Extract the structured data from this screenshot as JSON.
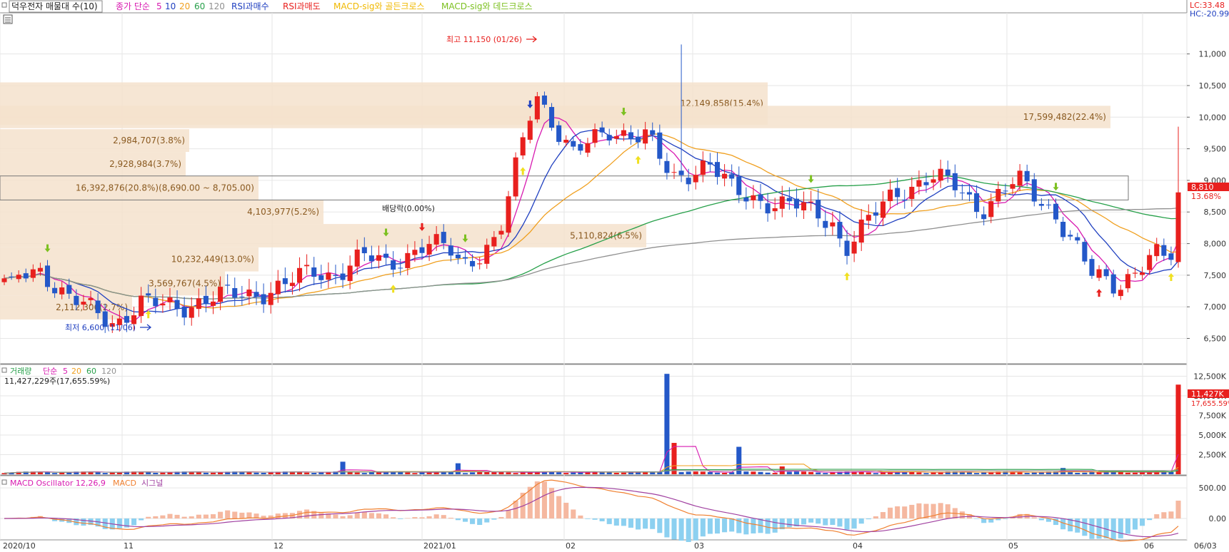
{
  "header": {
    "title": "덕우전자 매물대 수(10)",
    "ma_label": "종가 단순",
    "ma_periods": [
      "5",
      "10",
      "20",
      "60",
      "120"
    ],
    "rsi_buy": "RSI과매수",
    "rsi_sell": "RSI과매도",
    "golden_cross": "MACD-sig와 골든크로스",
    "dead_cross": "MACD-sig와 데드크로스",
    "lc_label": "LC:33.48",
    "hc_label": "HC:-20.99"
  },
  "colors": {
    "up": "#e8201e",
    "down": "#2458c8",
    "ma5": "#d81ab0",
    "ma10": "#2040c0",
    "ma20": "#f0a020",
    "ma60": "#27a04a",
    "ma120": "#909090",
    "volume_profile": "#f5e2cc",
    "macd": "#f08030",
    "signal": "#a040a0",
    "osc_pos": "#f5b8a0",
    "osc_neg": "#8cd0f0"
  },
  "chart_data": [
    {
      "type": "candlestick",
      "name": "price",
      "ylim": [
        6100,
        11650
      ],
      "y_ticks": [
        "11,000",
        "10,500",
        "10,000",
        "9,500",
        "9,000",
        "8,500",
        "8,000",
        "7,500",
        "7,000",
        "6,500"
      ],
      "y_tick_values": [
        11000,
        10500,
        10000,
        9500,
        9000,
        8500,
        8000,
        7500,
        7000,
        6500
      ],
      "x_labels": [
        "2020/10",
        "11",
        "12",
        "2021/01",
        "02",
        "03",
        "04",
        "05",
        "06",
        "06/03"
      ],
      "last_price_label": "8,810",
      "last_change_label": "13.68%",
      "volume_profile": [
        {
          "low": 9880,
          "high": 10550,
          "label": "12,149,858(15.4%)"
        },
        {
          "low": 9825,
          "high": 10180,
          "label": "17,599,482(22.4%)"
        },
        {
          "low": 9450,
          "high": 9810,
          "label": "2,984,707(3.8%)"
        },
        {
          "low": 9070,
          "high": 9450,
          "label": "2,928,984(3.7%)"
        },
        {
          "low": 8690,
          "high": 9070,
          "label": "16,392,876(20.8%)(8,690.00 ~ 8,705.00)"
        },
        {
          "low": 8310,
          "high": 8690,
          "label": "4,103,977(5.2%)"
        },
        {
          "low": 7940,
          "high": 8310,
          "label": "5,110,824(6.5%)"
        },
        {
          "low": 7560,
          "high": 7940,
          "label": "10,232,449(13.0%)"
        },
        {
          "low": 7180,
          "high": 7560,
          "label": "3,569,767(4.5%)"
        },
        {
          "low": 6800,
          "high": 7180,
          "label": "2,112,306(2.7%)"
        }
      ],
      "annotations": {
        "high": "최고 11,150 (01/26)",
        "low": "최저 6,600 (11/06)",
        "dividend": "배당락(0.00%)"
      },
      "highest": 11150,
      "lowest": 6600,
      "last_close": 8810
    },
    {
      "type": "bar",
      "name": "volume",
      "legend": [
        "거래량",
        "단순",
        "5",
        "20",
        "60",
        "120"
      ],
      "info": "11,427,229주(17,655.59%)",
      "ylim": [
        0,
        14000
      ],
      "y_ticks": [
        "12,500K",
        "10,000K",
        "7,500K",
        "5,000K",
        "2,500K"
      ],
      "last_label": "11,427K",
      "last_pct_label": "17,655.59%"
    },
    {
      "type": "line",
      "name": "macd",
      "legend": [
        "MACD Oscillator 12,26,9",
        "MACD",
        "시그널"
      ],
      "ylim": [
        -350,
        700
      ],
      "y_ticks": [
        "500.00",
        "0.00"
      ]
    }
  ]
}
